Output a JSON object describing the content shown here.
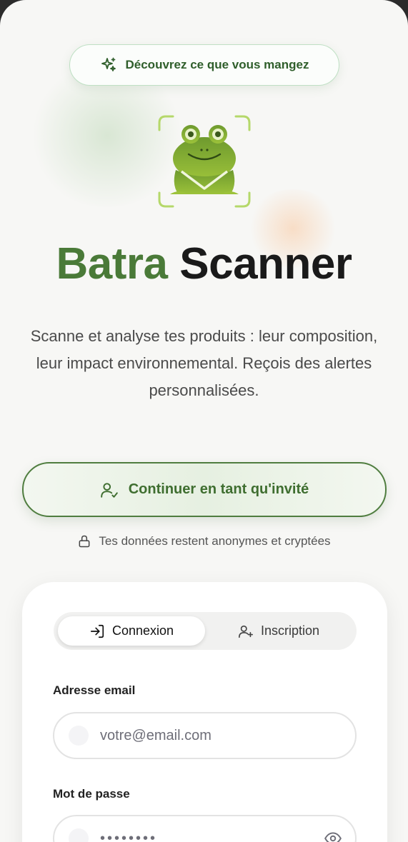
{
  "tagline": {
    "text": "Découvrez ce que vous mangez"
  },
  "hero": {
    "title_part1": "Batra",
    "title_part2": "Scanner",
    "description": "Scanne et analyse tes produits : leur composition, leur impact environnemental. Reçois des alertes personnalisées."
  },
  "guest": {
    "button_label": "Continuer en tant qu'invité",
    "privacy_note": "Tes données restent anonymes et cryptées"
  },
  "auth": {
    "tabs": [
      {
        "label": "Connexion",
        "active": true
      },
      {
        "label": "Inscription",
        "active": false
      }
    ],
    "email_label": "Adresse email",
    "email_placeholder": "votre@email.com",
    "password_label": "Mot de passe",
    "password_value": "••••••••"
  },
  "colors": {
    "brand_green": "#4a7a38",
    "accent_lime": "#b5d86a",
    "background": "#f7f7f5"
  },
  "icons": {
    "tagline": "sparkles-icon",
    "guest": "user-check-icon",
    "privacy": "lock-icon",
    "login_tab": "log-in-icon",
    "signup_tab": "user-plus-icon",
    "password_toggle": "eye-icon"
  }
}
